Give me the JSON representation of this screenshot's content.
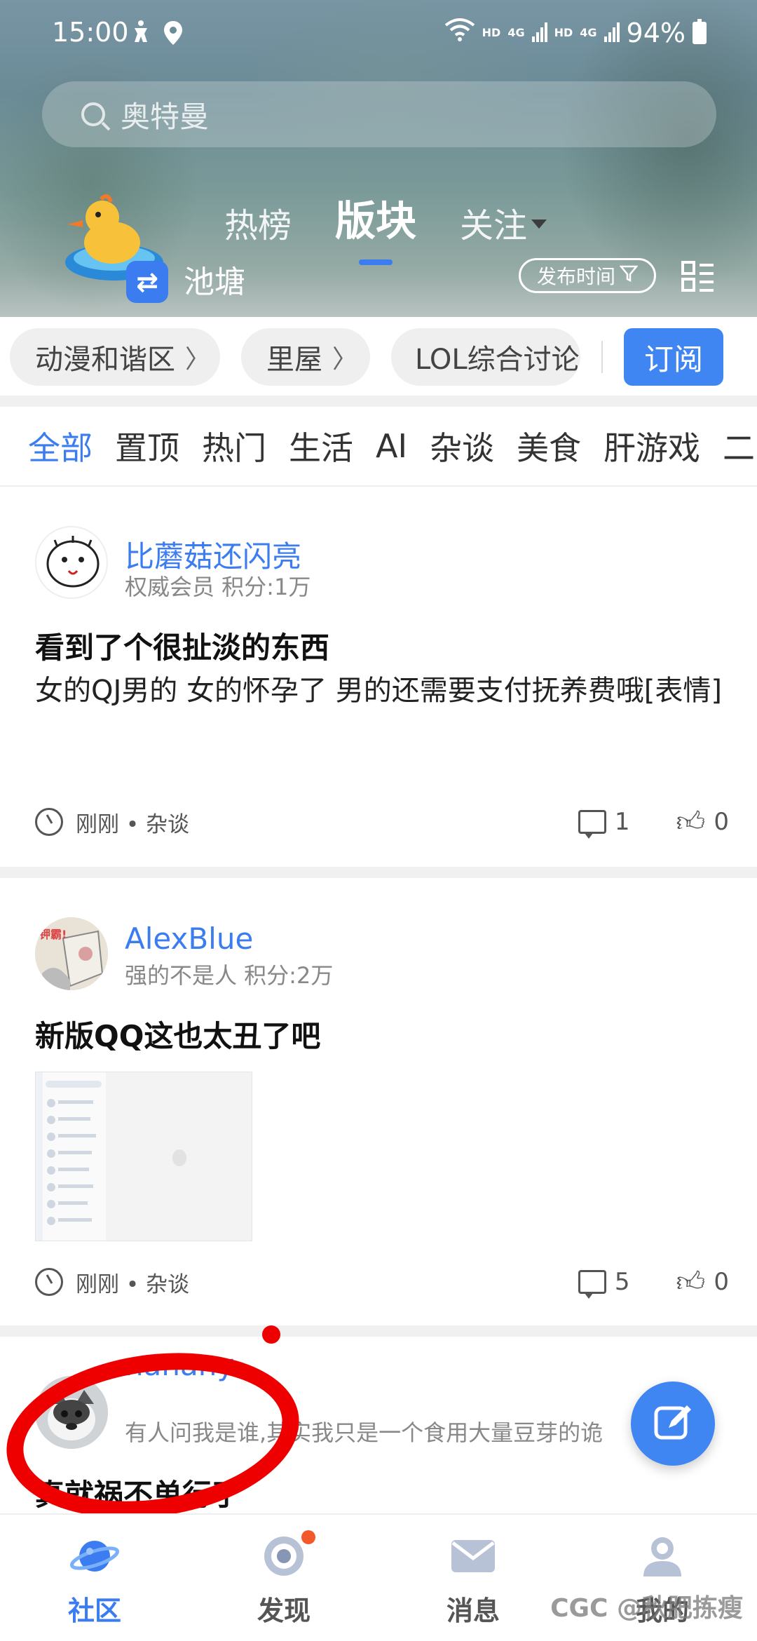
{
  "status_bar": {
    "time": "15:00",
    "hd1": "HD",
    "net1": "4G",
    "hd2": "HD",
    "net2": "4G",
    "battery": "94%"
  },
  "search": {
    "placeholder": "奥特曼"
  },
  "header": {
    "tabs": [
      "热榜",
      "版块",
      "关注"
    ],
    "active_tab": "版块",
    "pond_label": "池塘",
    "sort_button": "发布时间",
    "switch_glyph": "⇄"
  },
  "boards": {
    "chips": [
      "动漫和谐区",
      "里屋",
      "LOL综合讨论"
    ],
    "subscribe_label": "订阅"
  },
  "categories": [
    "全部",
    "置顶",
    "热门",
    "生活",
    "AI",
    "杂谈",
    "美食",
    "肝游戏",
    "二"
  ],
  "active_category": "全部",
  "posts": [
    {
      "username": "比蘑菇还闪亮",
      "meta": "权威会员  积分:1万",
      "title": "看到了个很扯淡的东西",
      "body": "女的QJ男的 女的怀孕了 男的还需要支付抚养费哦[表情]",
      "time": "刚刚 • 杂谈",
      "comments": "1",
      "likes": "0"
    },
    {
      "username": "AlexBlue",
      "meta": "强的不是人  积分:2万",
      "title": "新版QQ这也太丑了吧",
      "time": "刚刚 • 杂谈",
      "comments": "5",
      "likes": "0",
      "avatar_text": "钾霸!"
    },
    {
      "username": "nanany",
      "meta": "有人问我是谁,其实我只是一个食用大量豆芽的诡",
      "title": "真就祸不单行了"
    }
  ],
  "bottom_nav": [
    {
      "label": "社区",
      "icon": "planet-icon",
      "active": true
    },
    {
      "label": "发现",
      "icon": "discover-icon",
      "badge": true
    },
    {
      "label": "消息",
      "icon": "mail-icon"
    },
    {
      "label": "我的",
      "icon": "user-icon"
    }
  ],
  "watermark": "CGC @秋肥拣瘦",
  "colors": {
    "accent": "#3b7cf0",
    "badge": "#f25a2c",
    "annotation": "#ee0000"
  }
}
